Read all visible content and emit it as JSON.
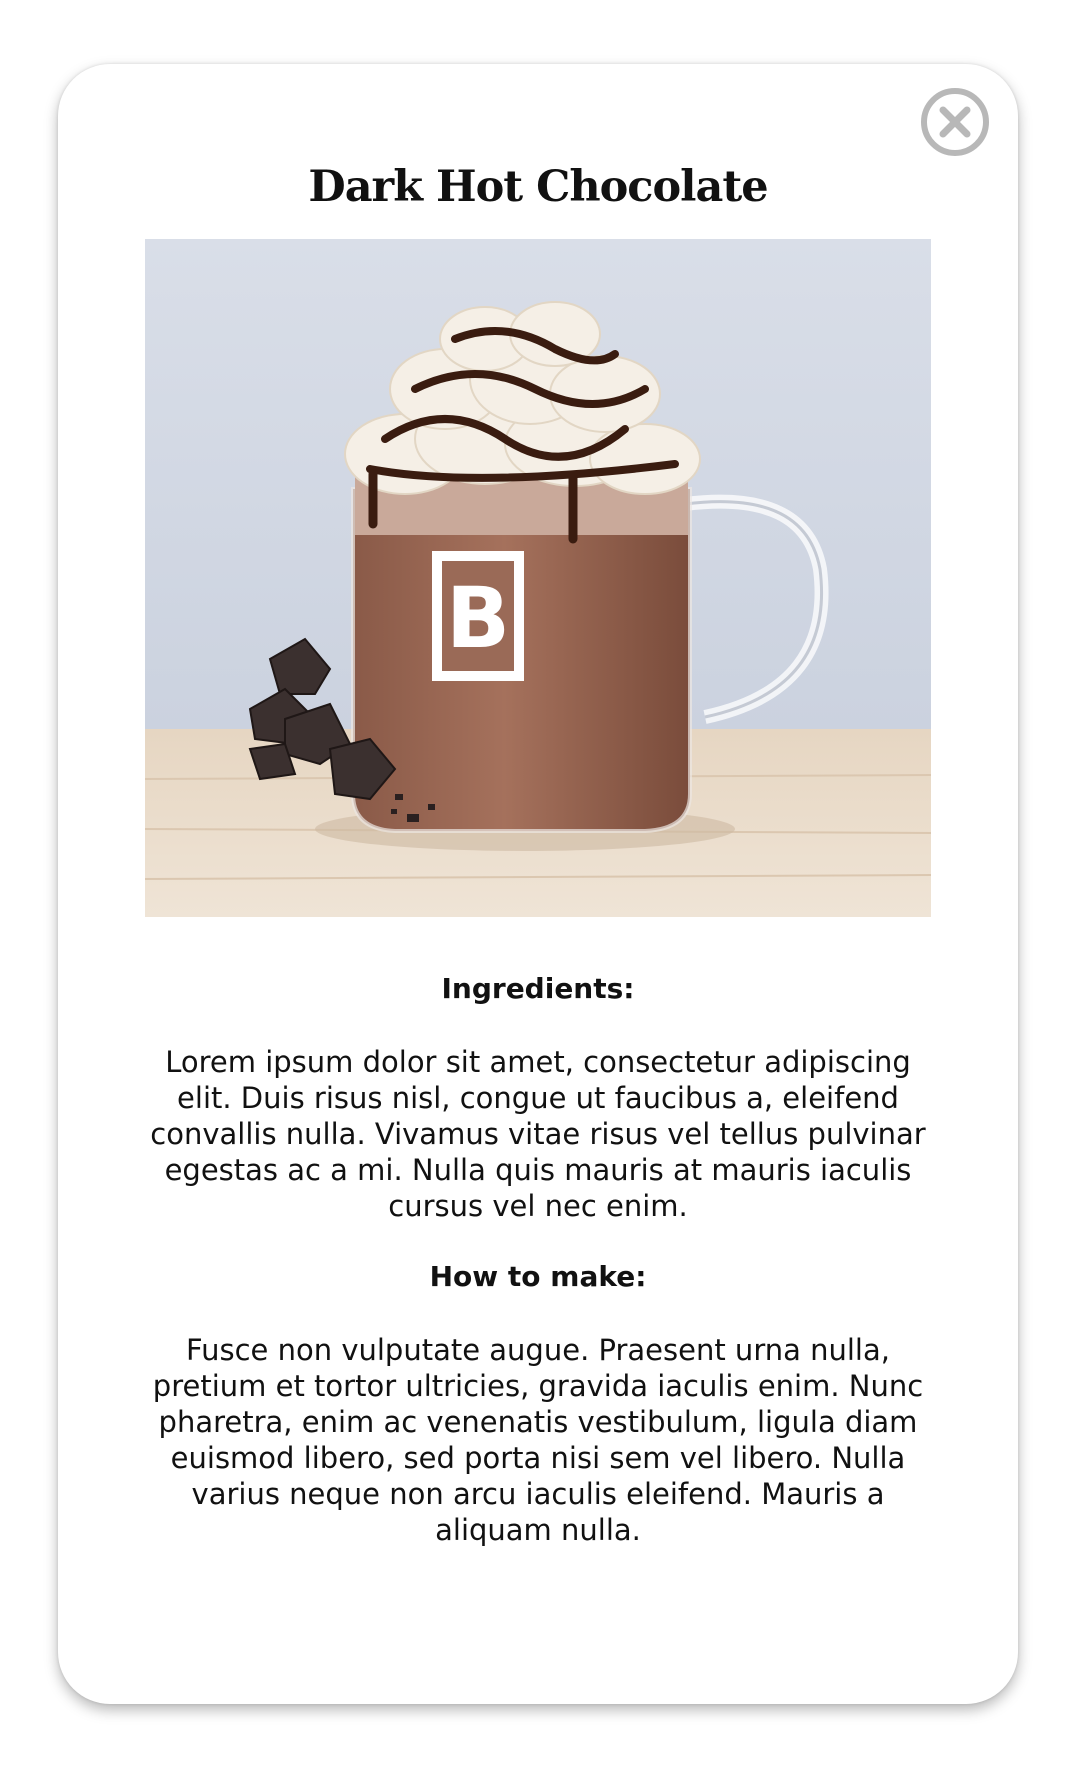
{
  "card": {
    "title": "Dark Hot Chocolate",
    "close_icon": "close-circle-icon"
  },
  "photo": {
    "mug_logo_letter": "B"
  },
  "ingredients": {
    "heading": "Ingredients:",
    "text": "Lorem ipsum dolor sit amet, consectetur adipiscing elit. Duis risus nisl, congue ut faucibus a, eleifend convallis nulla. Vivamus vitae risus vel tellus pulvinar egestas ac a mi. Nulla quis mauris at mauris iaculis cursus vel nec enim."
  },
  "how_to_make": {
    "heading": "How to make:",
    "text": "Fusce non vulputate augue. Praesent urna nulla, pretium et tortor ultricies, gravida iaculis enim. Nunc pharetra, enim ac venenatis vestibulum, ligula diam euismod libero, sed porta nisi sem vel libero. Nulla varius neque non arcu iaculis eleifend. Mauris a aliquam nulla."
  },
  "colors": {
    "close_icon": "#b8b8b8",
    "text": "#111111",
    "background": "#ffffff"
  }
}
